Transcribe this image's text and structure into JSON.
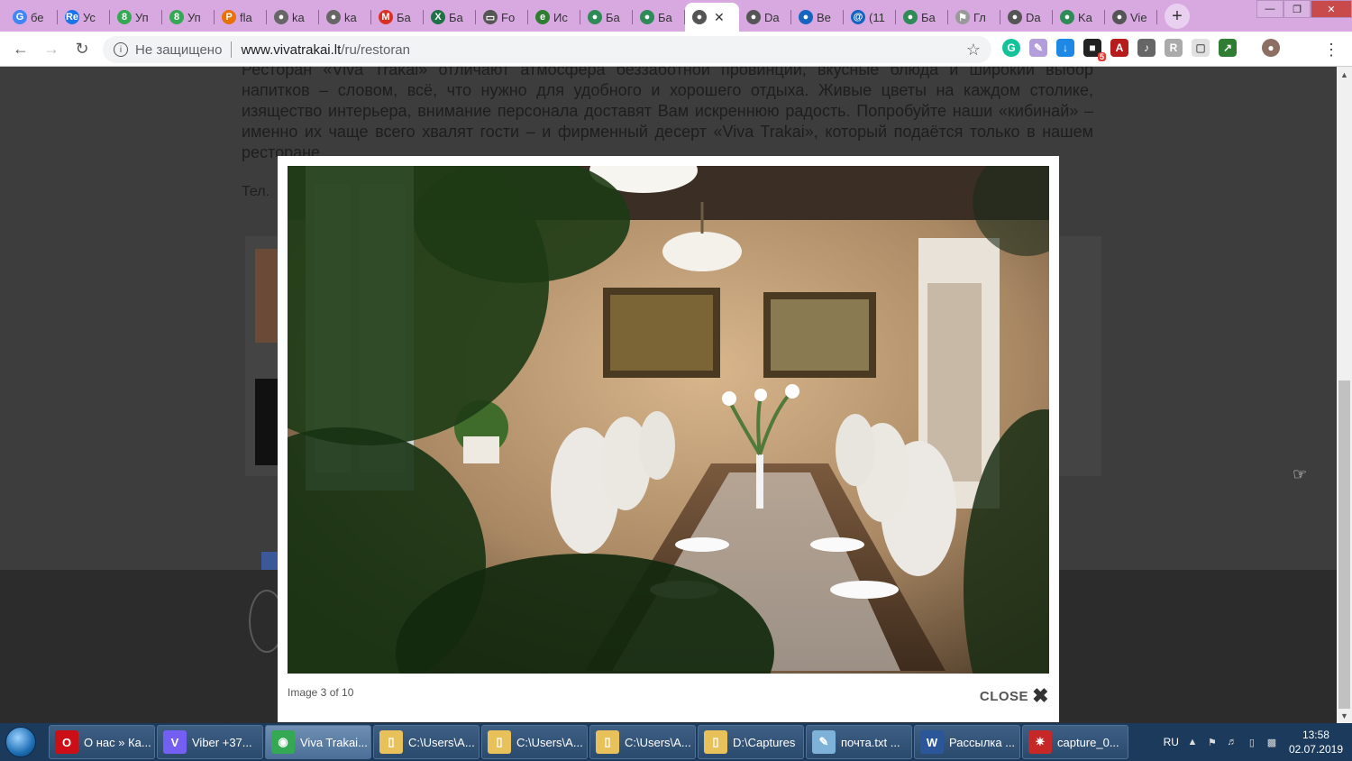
{
  "browser": {
    "tabs": [
      {
        "label": "бе",
        "icon": "google-icon",
        "color": "#4285f4"
      },
      {
        "label": "Ус",
        "icon": "re-icon",
        "color": "#1a73e8"
      },
      {
        "label": "Уп",
        "icon": "s-icon",
        "color": "#34a853"
      },
      {
        "label": "Уп",
        "icon": "s-icon",
        "color": "#34a853"
      },
      {
        "label": "fla",
        "icon": "pma-icon",
        "color": "#e8710a"
      },
      {
        "label": "ka",
        "icon": "globe-icon",
        "color": "#666666"
      },
      {
        "label": "ka",
        "icon": "globe-icon",
        "color": "#666666"
      },
      {
        "label": "Ба",
        "icon": "gmail-icon",
        "color": "#d93025"
      },
      {
        "label": "Ба",
        "icon": "excel-icon",
        "color": "#1e7145"
      },
      {
        "label": "Fo",
        "icon": "monitor-icon",
        "color": "#555555"
      },
      {
        "label": "Ис",
        "icon": "doc-icon",
        "color": "#2e7d32"
      },
      {
        "label": "Ба",
        "icon": "earth-icon",
        "color": "#2e8b57"
      },
      {
        "label": "Ба",
        "icon": "earth-icon",
        "color": "#2e8b57"
      },
      {
        "label": "",
        "icon": "globe-icon",
        "color": "#555555",
        "active": true
      },
      {
        "label": "Da",
        "icon": "globe-icon",
        "color": "#555555"
      },
      {
        "label": "Be",
        "icon": "earth-icon",
        "color": "#1565c0"
      },
      {
        "label": "(11",
        "icon": "at-icon",
        "color": "#1565c0"
      },
      {
        "label": "Ба",
        "icon": "earth-icon",
        "color": "#2e8b57"
      },
      {
        "label": "Гл",
        "icon": "flag-icon",
        "color": "#999999"
      },
      {
        "label": "Da",
        "icon": "globe-icon",
        "color": "#555555"
      },
      {
        "label": "Ka",
        "icon": "earth-icon",
        "color": "#2e8b57"
      },
      {
        "label": "Vie",
        "icon": "globe-icon",
        "color": "#555555"
      }
    ],
    "new_tab": "+",
    "address": {
      "security_text": "Не защищено",
      "domain": "www.vivatrakai.lt",
      "path": "/ru/restoran"
    },
    "extension_badge": "5"
  },
  "page": {
    "paragraph": "Ресторан «Viva Trakai» отличают атмосфера беззаботной провинции, вкусные блюда и широкий выбор напитков – словом, всё, что нужно для удобного и хорошего отдыха. Живые цветы на каждом столике, изящество интерьера, внимание персонала доставят Вам искреннюю радость. Попробуйте наши «кибинай» – именно их чаще всего хвалят гости – и фирменный десерт «Viva Trakai», который подаётся только в нашем ресторане.",
    "tel": "Тел."
  },
  "lightbox": {
    "caption": "Image 3 of 10",
    "close_label": "CLOSE"
  },
  "taskbar": {
    "items": [
      {
        "label": "О нас » Ка...",
        "icon": "opera-icon",
        "color": "#cc0f16"
      },
      {
        "label": "Viber +37...",
        "icon": "viber-icon",
        "color": "#7360f2"
      },
      {
        "label": "Viva Trakai...",
        "icon": "chrome-icon",
        "color": "#34a853",
        "active": true
      },
      {
        "label": "C:\\Users\\A...",
        "icon": "folder-icon",
        "color": "#e8c15a"
      },
      {
        "label": "C:\\Users\\A...",
        "icon": "folder-icon",
        "color": "#e8c15a"
      },
      {
        "label": "C:\\Users\\A...",
        "icon": "folder-icon",
        "color": "#e8c15a"
      },
      {
        "label": "D:\\Captures",
        "icon": "folder-icon",
        "color": "#e8c15a"
      },
      {
        "label": "почта.txt ...",
        "icon": "notepad-icon",
        "color": "#7fb2d9"
      },
      {
        "label": "Рассылка ...",
        "icon": "word-icon",
        "color": "#2b579a"
      },
      {
        "label": "capture_0...",
        "icon": "capture-icon",
        "color": "#c62828"
      }
    ],
    "lang": "RU",
    "time": "13:58",
    "date": "02.07.2019"
  }
}
